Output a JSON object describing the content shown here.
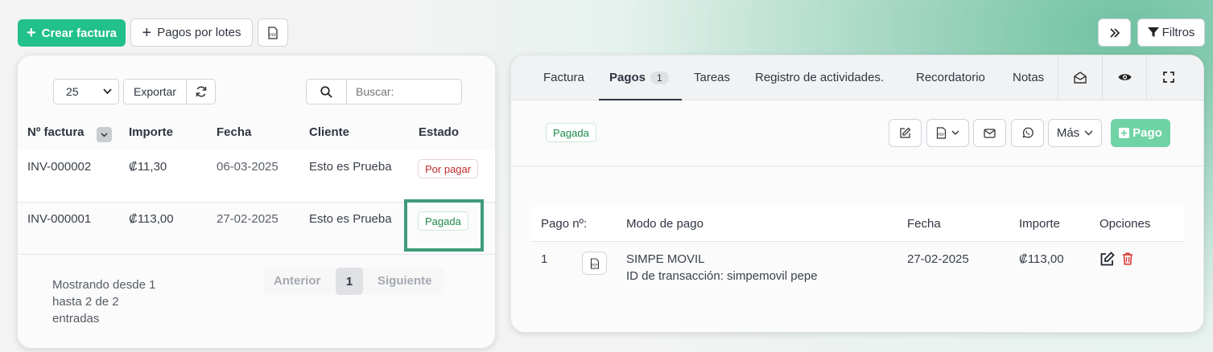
{
  "toolbar": {
    "create_invoice": "Crear factura",
    "batch_payments": "Pagos por lotes",
    "filters": "Filtros"
  },
  "list": {
    "page_size": "25",
    "page_size_options": [
      "25"
    ],
    "export": "Exportar",
    "search_placeholder": "Buscar:",
    "columns": {
      "number": "Nº factura",
      "amount": "Importe",
      "date": "Fecha",
      "client": "Cliente",
      "status": "Estado"
    },
    "rows": [
      {
        "number": "INV-000002",
        "amount": "₡11,30",
        "date": "06-03-2025",
        "client": "Esto es Prueba",
        "status": "Por pagar"
      },
      {
        "number": "INV-000001",
        "amount": "₡113,00",
        "date": "27-02-2025",
        "client": "Esto es Prueba",
        "status": "Pagada"
      }
    ],
    "info_line1": "Mostrando desde 1",
    "info_line2": "hasta 2 de 2",
    "info_line3": "entradas",
    "prev": "Anterior",
    "page": "1",
    "next": "Siguiente"
  },
  "detail": {
    "tabs": {
      "invoice": "Factura",
      "payments": "Pagos",
      "payments_count": "1",
      "tasks": "Tareas",
      "activity": "Registro de actividades.",
      "reminder": "Recordatorio",
      "notes": "Notas"
    },
    "status": "Pagada",
    "more": "Más",
    "add_payment": "Pago",
    "payments_table": {
      "columns": {
        "number": "Pago nº:",
        "mode": "Modo de pago",
        "date": "Fecha",
        "amount": "Importe",
        "options": "Opciones"
      },
      "rows": [
        {
          "number": "1",
          "mode": "SIMPE MOVIL",
          "transaction": "ID de transacción: simpemovil pepe",
          "date": "27-02-2025",
          "amount": "₡113,00"
        }
      ]
    }
  },
  "colors": {
    "accent_green": "#22c08a",
    "highlight_box": "#3f9c78",
    "danger": "#d9302c"
  }
}
